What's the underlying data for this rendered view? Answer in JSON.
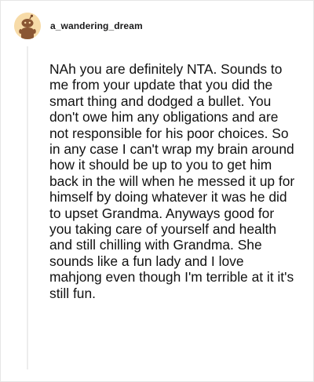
{
  "comment": {
    "username": "a_wandering_dream",
    "avatar_icon": "snoo-avatar-icon",
    "avatar_bg": "#f7dba8",
    "body": "NAh you are definitely NTA. Sounds to me from your update that you did the smart thing and dodged a bullet. You don't owe him any obligations and are not responsible for his poor choices. So in any case I can't wrap my brain around how it should be up to you to get him back in the will when he messed it up for himself by doing whatever it was he did to upset Grandma. Anyways good for you taking care of yourself and health and still chilling with Grandma. She sounds like a fun lady and I love mahjong even though I'm terrible at it it's still fun."
  }
}
